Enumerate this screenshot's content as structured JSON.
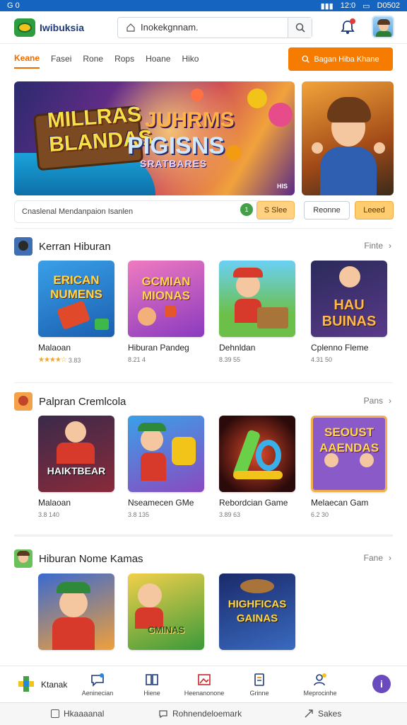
{
  "status_bar": {
    "left": "G 0",
    "right_1": "12:0",
    "right_2": "D0502"
  },
  "app": {
    "title": "Iwibuksia"
  },
  "search": {
    "value": "Inokekgnnam."
  },
  "nav_tabs": [
    "Keane",
    "Fasei",
    "Rone",
    "Rops",
    "Hoane",
    "Hiko"
  ],
  "cta_label": "Bagan Hiba Khane",
  "hero": {
    "line1": "MILLRAS",
    "line2": "BLANDAS",
    "line3": "JUHRMS",
    "line4": "PIGISNS",
    "line5": "SRATBARES",
    "tag": "HIS"
  },
  "promo": {
    "text": "Cnaslenal Mendanpaion Isanlen",
    "dot": "1",
    "button": "S Slee",
    "outline_btn": "Reonne",
    "amber_btn": "Leeed"
  },
  "sections": [
    {
      "title": "Kerran Hiburan",
      "more": "Finte",
      "cards": [
        {
          "name": "Malaoan",
          "thumb_text": "ERICAN NUMENS",
          "meta": "3.83",
          "stars": "★★★★☆"
        },
        {
          "name": "Hiburan Pandeg",
          "thumb_text": "GCMIAN MIONAS",
          "meta": "8.21 4",
          "stars": ""
        },
        {
          "name": "Dehnldan",
          "thumb_text": "",
          "meta": "8.39 55",
          "stars": ""
        },
        {
          "name": "Cplenno Fleme",
          "thumb_text": "HAU BUINAS",
          "meta": "4.31 50",
          "stars": ""
        }
      ]
    },
    {
      "title": "Palpran Cremlcola",
      "more": "Pans",
      "cards": [
        {
          "name": "Malaoan",
          "thumb_text": "HAIKTBEAR",
          "meta": "3.8 140",
          "stars": ""
        },
        {
          "name": "Nseamecen GMe",
          "thumb_text": "",
          "meta": "3.8 135",
          "stars": ""
        },
        {
          "name": "Rebordcian Game",
          "thumb_text": "",
          "meta": "3.89 63",
          "stars": ""
        },
        {
          "name": "Melaecan Gam",
          "thumb_text": "SEOUST AAENDAS",
          "meta": "6.2 30",
          "stars": ""
        }
      ]
    },
    {
      "title": "Hiburan Nome Kamas",
      "more": "Fane",
      "cards": [
        {
          "name": "",
          "thumb_text": "",
          "meta": "",
          "stars": ""
        },
        {
          "name": "",
          "thumb_text": "GMINAS",
          "meta": "",
          "stars": ""
        },
        {
          "name": "",
          "thumb_text": "HIGHFICAS GAINAS",
          "meta": "",
          "stars": ""
        }
      ]
    }
  ],
  "bottom_nav": {
    "logo_label": "Ktanak",
    "items": [
      "Aeninecian",
      "Hiene",
      "Heenanonone",
      "Grinne",
      "Meprocinhe"
    ],
    "profile": "i"
  },
  "system_bar": [
    "Hkaaaanal",
    "Rohnendeloemark",
    "Sakes"
  ],
  "colors": {
    "accent": "#f57c00",
    "brand": "#1e3a78",
    "status": "#1565c0"
  }
}
